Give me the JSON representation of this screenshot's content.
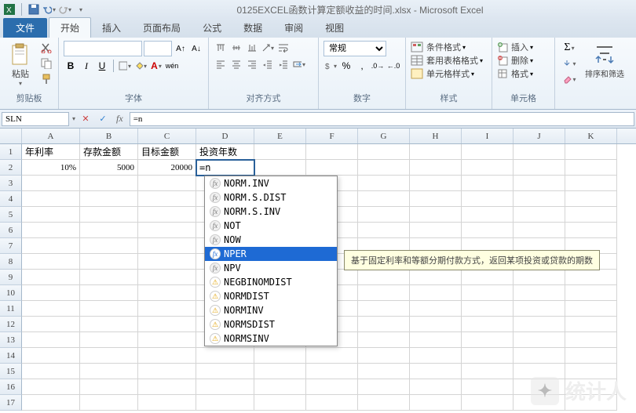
{
  "window": {
    "title": "0125EXCEL函数计算定额收益的时间.xlsx - Microsoft Excel"
  },
  "tabs": {
    "file": "文件",
    "items": [
      "开始",
      "插入",
      "页面布局",
      "公式",
      "数据",
      "审阅",
      "视图"
    ],
    "active_index": 0
  },
  "ribbon": {
    "clipboard": {
      "paste": "粘贴",
      "label": "剪贴板"
    },
    "font": {
      "label": "字体",
      "font_name": "",
      "font_size": ""
    },
    "alignment": {
      "label": "对齐方式"
    },
    "number": {
      "label": "数字",
      "format": "常规"
    },
    "styles": {
      "label": "样式",
      "cond": "条件格式",
      "table": "套用表格格式",
      "cell": "单元格样式"
    },
    "cells": {
      "label": "单元格",
      "insert": "插入",
      "delete": "删除",
      "format": "格式"
    },
    "editing": {
      "label": "",
      "sortfilter": "排序和筛选"
    }
  },
  "namebox": {
    "value": "SLN"
  },
  "formula": {
    "value": "=n"
  },
  "headers": [
    "A",
    "B",
    "C",
    "D",
    "E",
    "F",
    "G",
    "H",
    "I",
    "J",
    "K"
  ],
  "row_numbers": [
    1,
    2,
    3,
    4,
    5,
    6,
    7,
    8,
    9,
    10,
    11,
    12,
    13,
    14,
    15,
    16,
    17
  ],
  "chart_data": {
    "type": "table",
    "headers_row": [
      "年利率",
      "存款金额",
      "目标金额",
      "投资年数"
    ],
    "data_rows": [
      [
        "10%",
        "5000",
        "20000",
        "=n"
      ]
    ]
  },
  "cells": {
    "A1": "年利率",
    "B1": "存款金额",
    "C1": "目标金额",
    "D1": "投资年数",
    "A2": "10%",
    "B2": "5000",
    "C2": "20000",
    "D2": "=n"
  },
  "autocomplete": {
    "items": [
      {
        "name": "NORM.INV",
        "type": "new"
      },
      {
        "name": "NORM.S.DIST",
        "type": "new"
      },
      {
        "name": "NORM.S.INV",
        "type": "new"
      },
      {
        "name": "NOT",
        "type": "new"
      },
      {
        "name": "NOW",
        "type": "new"
      },
      {
        "name": "NPER",
        "type": "new",
        "selected": true
      },
      {
        "name": "NPV",
        "type": "new"
      },
      {
        "name": "NEGBINOMDIST",
        "type": "warn"
      },
      {
        "name": "NORMDIST",
        "type": "warn"
      },
      {
        "name": "NORMINV",
        "type": "warn"
      },
      {
        "name": "NORMSDIST",
        "type": "warn"
      },
      {
        "name": "NORMSINV",
        "type": "warn"
      }
    ],
    "tooltip": "基于固定利率和等额分期付款方式，返回某项投资或贷款的期数"
  },
  "watermark": {
    "text": "统计人"
  }
}
